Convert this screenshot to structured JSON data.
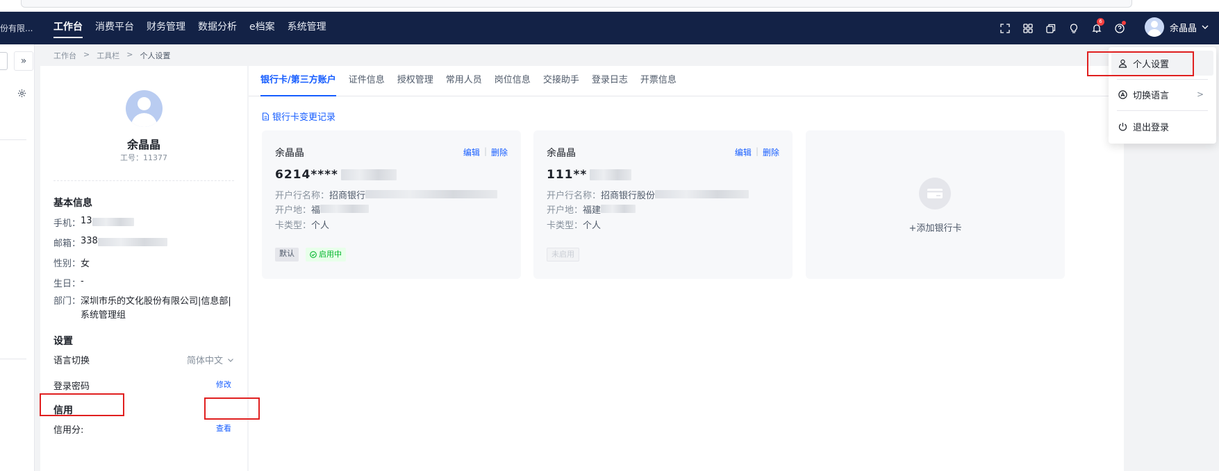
{
  "colors": {
    "nav_bg": "#132246",
    "accent": "#165dff",
    "success": "#00b42a",
    "annotation": "#e02020"
  },
  "header": {
    "company": "份有限...",
    "menu": [
      {
        "label": "工作台",
        "active": true
      },
      {
        "label": "消费平台"
      },
      {
        "label": "财务管理"
      },
      {
        "label": "数据分析"
      },
      {
        "label": "e档案"
      },
      {
        "label": "系统管理"
      }
    ],
    "icons": [
      "fullscreen-icon",
      "apps-icon",
      "copy-icon",
      "lightbulb-icon",
      "bell-icon",
      "help-icon"
    ],
    "notification_count": "6",
    "user_name": "余晶晶"
  },
  "breadcrumb": [
    "工作台",
    "工具栏",
    "个人设置"
  ],
  "profile": {
    "name": "余晶晶",
    "employee_no": "工号：11377",
    "basic_title": "基本信息",
    "phone_label": "手机：",
    "phone_value": "13",
    "email_label": "邮箱：",
    "email_value": "338",
    "gender_label": "性别：",
    "gender_value": "女",
    "birthday_label": "生日：",
    "birthday_value": "-",
    "dept_label": "部门：",
    "dept_value": "深圳市乐的文化股份有限公司|信息部|系统管理组",
    "settings_title": "设置",
    "language_label": "语言切换",
    "language_value": "简体中文",
    "password_label": "登录密码",
    "password_action": "修改",
    "credit_title": "信用",
    "credit_label": "信用分:",
    "credit_action": "查看"
  },
  "tabs": [
    "银行卡/第三方账户",
    "证件信息",
    "授权管理",
    "常用人员",
    "岗位信息",
    "交接助手",
    "登录日志",
    "开票信息"
  ],
  "change_log": "银行卡变更记录",
  "cards": [
    {
      "holder": "余晶晶",
      "edit": "编辑",
      "delete": "删除",
      "number": "6214****",
      "bank_label": "开户行名称：",
      "bank_value": "招商银行",
      "location_label": "开户地：",
      "location_value": "福",
      "type_label": "卡类型：",
      "type_value": "个人",
      "default_tag": "默认",
      "status_tag": "启用中"
    },
    {
      "holder": "余晶晶",
      "edit": "编辑",
      "delete": "删除",
      "number": "111**",
      "bank_label": "开户行名称：",
      "bank_value": "招商银行股份",
      "location_label": "开户地：",
      "location_value": "福建",
      "type_label": "卡类型：",
      "type_value": "个人",
      "status_tag": "未启用"
    }
  ],
  "add_card": "+添加银行卡",
  "dropdown": {
    "items": [
      {
        "label": "个人设置",
        "icon": "user-icon"
      },
      {
        "label": "切换语言",
        "icon": "language-icon"
      },
      {
        "label": "退出登录",
        "icon": "power-icon"
      }
    ]
  }
}
